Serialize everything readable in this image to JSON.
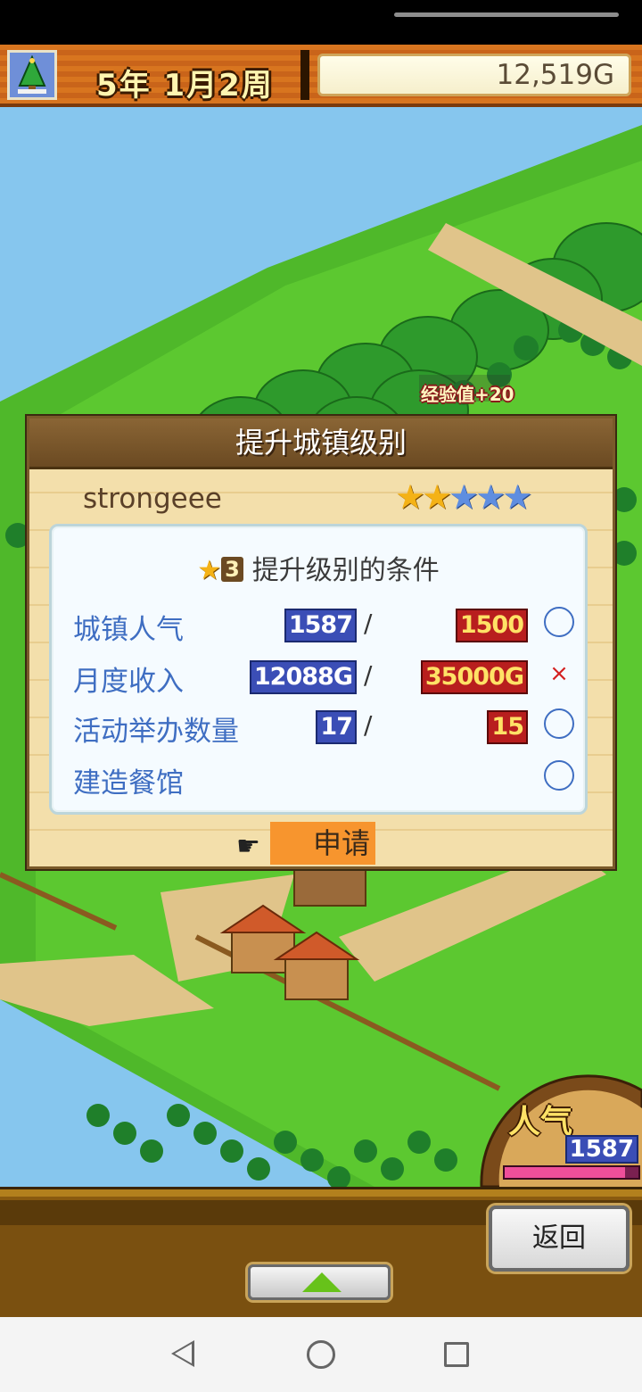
{
  "header": {
    "date": "5年 1月2周",
    "money": "12,519G"
  },
  "map": {
    "floating_text": "经验值+20"
  },
  "dialog": {
    "title": "提升城镇级别",
    "player_name": "strongeee",
    "stars": {
      "filled": 2,
      "total": 5
    },
    "conditions": {
      "level_badge": "3",
      "heading": "提升级别的条件",
      "rows": [
        {
          "label": "城镇人气",
          "current": "1587",
          "required": "1500",
          "status": "ok"
        },
        {
          "label": "月度收入",
          "current": "12088G",
          "required": "35000G",
          "status": "fail"
        },
        {
          "label": "活动举办数量",
          "current": "17",
          "required": "15",
          "status": "ok"
        },
        {
          "label": "建造餐馆",
          "current": "",
          "required": "",
          "status": "ok"
        }
      ],
      "slash": "/",
      "fail_mark": "×"
    },
    "apply_label": "申请"
  },
  "popularity": {
    "label": "人气",
    "value": "1587",
    "bar_fraction": 0.9
  },
  "bottom": {
    "back_label": "返回"
  },
  "colors": {
    "label_blue": "#3f6ec2",
    "fail_red": "#d42020",
    "apply_orange": "#f7952e"
  }
}
